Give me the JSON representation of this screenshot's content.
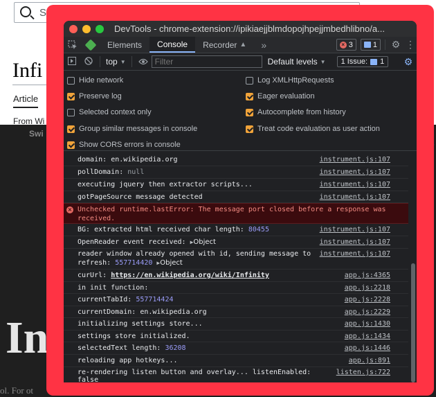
{
  "background": {
    "search_placeholder": "Se",
    "article_title": "Infi",
    "tab_article": "Article",
    "from_text": "From Wi",
    "switch_text": "Swi",
    "big_title": "In",
    "bottom_text": "ol. For ot",
    "slash": "/"
  },
  "window": {
    "title": "DevTools - chrome-extension://ipikiaejjblmdopojhpejjmbedhlibno/a..."
  },
  "tabs": {
    "elements": "Elements",
    "console": "Console",
    "recorder": "Recorder",
    "more": "»"
  },
  "badges": {
    "errors": "3",
    "messages": "1"
  },
  "toolbar": {
    "context": "top",
    "filter_placeholder": "Filter",
    "levels": "Default levels",
    "issues": "1 Issue:",
    "issues_count": "1"
  },
  "options": {
    "hide_network": "Hide network",
    "log_xhr": "Log XMLHttpRequests",
    "preserve_log": "Preserve log",
    "eager_eval": "Eager evaluation",
    "selected_context": "Selected context only",
    "autocomplete": "Autocomplete from history",
    "group_similar": "Group similar messages in console",
    "treat_code": "Treat code evaluation as user action",
    "show_cors": "Show CORS errors in console"
  },
  "log": {
    "r1": {
      "label": "domain:",
      "value": "en.wikipedia.org",
      "src": "instrument.js:107"
    },
    "r2": {
      "label": "pollDomain:",
      "value": "null",
      "src": "instrument.js:107"
    },
    "r3": {
      "text": "executing jquery then extractor scripts...",
      "src": "instrument.js:107"
    },
    "r4": {
      "text": "gotPageSource message detected",
      "src": "instrument.js:107"
    },
    "r5": {
      "text": "Unchecked runtime.lastError: The message port closed before a response was received."
    },
    "r6": {
      "label": "BG: extracted html received char length:",
      "value": "80455",
      "src": "instrument.js:107"
    },
    "r7": {
      "label": "OpenReader event received:",
      "value": "Object",
      "src": "instrument.js:107"
    },
    "r8": {
      "line1": "reader window already opened with id, sending message to",
      "label": "refresh:",
      "value": "557714420",
      "value2": "Object",
      "src": "instrument.js:107"
    },
    "r9": {
      "label": "curUrl:",
      "value": "https://en.wikipedia.org/wiki/Infinity",
      "src": "app.js:4365"
    },
    "r10": {
      "text": "in init function:",
      "src": "app.js:2218"
    },
    "r11": {
      "label": "currentTabId:",
      "value": "557714424",
      "src": "app.js:2228"
    },
    "r12": {
      "label": "currentDomain:",
      "value": "en.wikipedia.org",
      "src": "app.js:2229"
    },
    "r13": {
      "text": "initializing settings store...",
      "src": "app.js:1430"
    },
    "r14": {
      "text": "settings store initialized.",
      "src": "app.js:1434"
    },
    "r15": {
      "label": "selectedText length:",
      "value": "36208",
      "src": "app.js:1446"
    },
    "r16": {
      "text": "reloading app hotkeys...",
      "src": "app.js:891"
    },
    "r17": {
      "text": "re-rendering listen button and overlay... listenEnabled:",
      "value": "false",
      "src": "listen.js:722"
    }
  }
}
